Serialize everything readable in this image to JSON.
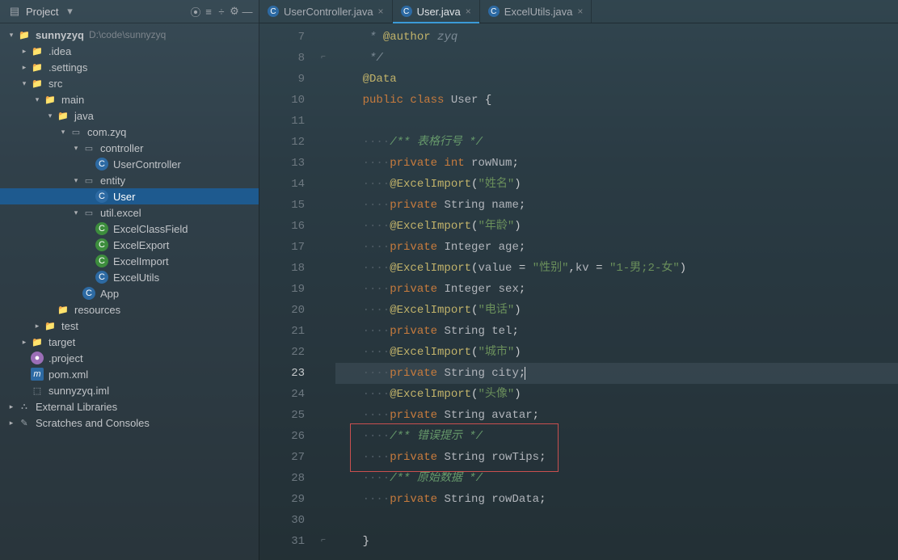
{
  "panel": {
    "title": "Project",
    "toolbar_icons": [
      "target-icon",
      "expand-icon",
      "collapse-icon",
      "gear-icon",
      "hide-icon"
    ]
  },
  "tree": [
    {
      "indent": 0,
      "chev": "v",
      "icon": "folder",
      "bold": true,
      "label": "sunnyzyq",
      "hint": "D:\\code\\sunnyzyq"
    },
    {
      "indent": 1,
      "chev": ">",
      "icon": "folder",
      "label": ".idea"
    },
    {
      "indent": 1,
      "chev": ">",
      "icon": "folder",
      "label": ".settings"
    },
    {
      "indent": 1,
      "chev": "v",
      "icon": "folder",
      "label": "src"
    },
    {
      "indent": 2,
      "chev": "v",
      "icon": "folder",
      "label": "main"
    },
    {
      "indent": 3,
      "chev": "v",
      "icon": "folder",
      "label": "java"
    },
    {
      "indent": 4,
      "chev": "v",
      "icon": "pkg",
      "label": "com.zyq"
    },
    {
      "indent": 5,
      "chev": "v",
      "icon": "pkg",
      "label": "controller"
    },
    {
      "indent": 6,
      "chev": "",
      "icon": "c",
      "label": "UserController"
    },
    {
      "indent": 5,
      "chev": "v",
      "icon": "pkg",
      "label": "entity"
    },
    {
      "indent": 6,
      "chev": "",
      "icon": "c",
      "label": "User",
      "selected": true
    },
    {
      "indent": 5,
      "chev": "v",
      "icon": "pkg",
      "label": "util.excel"
    },
    {
      "indent": 6,
      "chev": "",
      "icon": "g",
      "label": "ExcelClassField"
    },
    {
      "indent": 6,
      "chev": "",
      "icon": "g",
      "label": "ExcelExport"
    },
    {
      "indent": 6,
      "chev": "",
      "icon": "g",
      "label": "ExcelImport"
    },
    {
      "indent": 6,
      "chev": "",
      "icon": "c",
      "label": "ExcelUtils"
    },
    {
      "indent": 5,
      "chev": "",
      "icon": "c",
      "label": "App"
    },
    {
      "indent": 3,
      "chev": "",
      "icon": "folder",
      "label": "resources"
    },
    {
      "indent": 2,
      "chev": ">",
      "icon": "folder",
      "label": "test"
    },
    {
      "indent": 1,
      "chev": ">",
      "icon": "target",
      "label": "target"
    },
    {
      "indent": 1,
      "chev": "",
      "icon": "proj",
      "label": ".project"
    },
    {
      "indent": 1,
      "chev": "",
      "icon": "m",
      "label": "pom.xml"
    },
    {
      "indent": 1,
      "chev": "",
      "icon": "iml",
      "label": "sunnyzyq.iml"
    },
    {
      "indent": 0,
      "chev": ">",
      "icon": "lib",
      "label": "External Libraries"
    },
    {
      "indent": 0,
      "chev": ">",
      "icon": "scratch",
      "label": "Scratches and Consoles"
    }
  ],
  "tabs": [
    {
      "label": "UserController.java",
      "active": false
    },
    {
      "label": "User.java",
      "active": true
    },
    {
      "label": "ExcelUtils.java",
      "active": false
    }
  ],
  "code": {
    "first_line": 7,
    "caret_line": 23,
    "lines": [
      {
        "n": 7,
        "tokens": [
          {
            "t": "ws",
            "v": "    "
          },
          {
            "t": "comment",
            "v": " * "
          },
          {
            "t": "param",
            "v": "@author"
          },
          {
            "t": "comment",
            "v": " zyq"
          }
        ]
      },
      {
        "n": 8,
        "fold": "end",
        "tokens": [
          {
            "t": "ws",
            "v": "    "
          },
          {
            "t": "comment",
            "v": " */"
          }
        ]
      },
      {
        "n": 9,
        "tokens": [
          {
            "t": "ws",
            "v": "    "
          },
          {
            "t": "ann",
            "v": "@Data"
          }
        ]
      },
      {
        "n": 10,
        "tokens": [
          {
            "t": "ws",
            "v": "    "
          },
          {
            "t": "kw",
            "v": "public class "
          },
          {
            "t": "ident",
            "v": "User "
          },
          {
            "t": "op",
            "v": "{"
          }
        ]
      },
      {
        "n": 11,
        "tokens": []
      },
      {
        "n": 12,
        "tokens": [
          {
            "t": "ws",
            "v": "    ····"
          },
          {
            "t": "comm-g",
            "v": "/** 表格行号 */"
          }
        ]
      },
      {
        "n": 13,
        "tokens": [
          {
            "t": "ws",
            "v": "    ····"
          },
          {
            "t": "kw",
            "v": "private int "
          },
          {
            "t": "ident",
            "v": "rowNum"
          },
          {
            "t": "op",
            "v": ";"
          }
        ]
      },
      {
        "n": 14,
        "tokens": [
          {
            "t": "ws",
            "v": "    ····"
          },
          {
            "t": "ann",
            "v": "@ExcelImport"
          },
          {
            "t": "op",
            "v": "("
          },
          {
            "t": "str",
            "v": "\"姓名\""
          },
          {
            "t": "op",
            "v": ")"
          }
        ]
      },
      {
        "n": 15,
        "tokens": [
          {
            "t": "ws",
            "v": "    ····"
          },
          {
            "t": "kw",
            "v": "private "
          },
          {
            "t": "ident",
            "v": "String name"
          },
          {
            "t": "op",
            "v": ";"
          }
        ]
      },
      {
        "n": 16,
        "tokens": [
          {
            "t": "ws",
            "v": "    ····"
          },
          {
            "t": "ann",
            "v": "@ExcelImport"
          },
          {
            "t": "op",
            "v": "("
          },
          {
            "t": "str",
            "v": "\"年龄\""
          },
          {
            "t": "op",
            "v": ")"
          }
        ]
      },
      {
        "n": 17,
        "tokens": [
          {
            "t": "ws",
            "v": "    ····"
          },
          {
            "t": "kw",
            "v": "private "
          },
          {
            "t": "ident",
            "v": "Integer age"
          },
          {
            "t": "op",
            "v": ";"
          }
        ]
      },
      {
        "n": 18,
        "tokens": [
          {
            "t": "ws",
            "v": "    ····"
          },
          {
            "t": "ann",
            "v": "@ExcelImport"
          },
          {
            "t": "op",
            "v": "("
          },
          {
            "t": "ident",
            "v": "value "
          },
          {
            "t": "op",
            "v": "= "
          },
          {
            "t": "str",
            "v": "\"性别\""
          },
          {
            "t": "op",
            "v": ","
          },
          {
            "t": "ident",
            "v": "kv "
          },
          {
            "t": "op",
            "v": "= "
          },
          {
            "t": "str",
            "v": "\"1-男;2-女\""
          },
          {
            "t": "op",
            "v": ")"
          }
        ]
      },
      {
        "n": 19,
        "tokens": [
          {
            "t": "ws",
            "v": "    ····"
          },
          {
            "t": "kw",
            "v": "private "
          },
          {
            "t": "ident",
            "v": "Integer sex"
          },
          {
            "t": "op",
            "v": ";"
          }
        ]
      },
      {
        "n": 20,
        "tokens": [
          {
            "t": "ws",
            "v": "    ····"
          },
          {
            "t": "ann",
            "v": "@ExcelImport"
          },
          {
            "t": "op",
            "v": "("
          },
          {
            "t": "str",
            "v": "\"电话\""
          },
          {
            "t": "op",
            "v": ")"
          }
        ]
      },
      {
        "n": 21,
        "tokens": [
          {
            "t": "ws",
            "v": "    ····"
          },
          {
            "t": "kw",
            "v": "private "
          },
          {
            "t": "ident",
            "v": "String tel"
          },
          {
            "t": "op",
            "v": ";"
          }
        ]
      },
      {
        "n": 22,
        "tokens": [
          {
            "t": "ws",
            "v": "    ····"
          },
          {
            "t": "ann",
            "v": "@ExcelImport"
          },
          {
            "t": "op",
            "v": "("
          },
          {
            "t": "str",
            "v": "\"城市\""
          },
          {
            "t": "op",
            "v": ")"
          }
        ]
      },
      {
        "n": 23,
        "tokens": [
          {
            "t": "ws",
            "v": "    ····"
          },
          {
            "t": "kw",
            "v": "private "
          },
          {
            "t": "ident",
            "v": "String city"
          },
          {
            "t": "op",
            "v": ";"
          }
        ],
        "caret": true
      },
      {
        "n": 24,
        "tokens": [
          {
            "t": "ws",
            "v": "    ····"
          },
          {
            "t": "ann",
            "v": "@ExcelImport"
          },
          {
            "t": "op",
            "v": "("
          },
          {
            "t": "str",
            "v": "\"头像\""
          },
          {
            "t": "op",
            "v": ")"
          }
        ]
      },
      {
        "n": 25,
        "tokens": [
          {
            "t": "ws",
            "v": "    ····"
          },
          {
            "t": "kw",
            "v": "private "
          },
          {
            "t": "ident",
            "v": "String avatar"
          },
          {
            "t": "op",
            "v": ";"
          }
        ]
      },
      {
        "n": 26,
        "tokens": [
          {
            "t": "ws",
            "v": "    ····"
          },
          {
            "t": "comm-g",
            "v": "/** 错误提示 */"
          }
        ]
      },
      {
        "n": 27,
        "tokens": [
          {
            "t": "ws",
            "v": "    ····"
          },
          {
            "t": "kw",
            "v": "private "
          },
          {
            "t": "ident",
            "v": "String rowTips"
          },
          {
            "t": "op",
            "v": ";"
          }
        ]
      },
      {
        "n": 28,
        "tokens": [
          {
            "t": "ws",
            "v": "    ····"
          },
          {
            "t": "comm-g",
            "v": "/** 原始数据 */"
          }
        ]
      },
      {
        "n": 29,
        "tokens": [
          {
            "t": "ws",
            "v": "    ····"
          },
          {
            "t": "kw",
            "v": "private "
          },
          {
            "t": "ident",
            "v": "String rowData"
          },
          {
            "t": "op",
            "v": ";"
          }
        ]
      },
      {
        "n": 30,
        "tokens": []
      },
      {
        "n": 31,
        "fold": "end",
        "tokens": [
          {
            "t": "ws",
            "v": "    "
          },
          {
            "t": "op",
            "v": "}"
          }
        ]
      }
    ],
    "highlight_box": {
      "from": 26,
      "to": 27
    }
  }
}
